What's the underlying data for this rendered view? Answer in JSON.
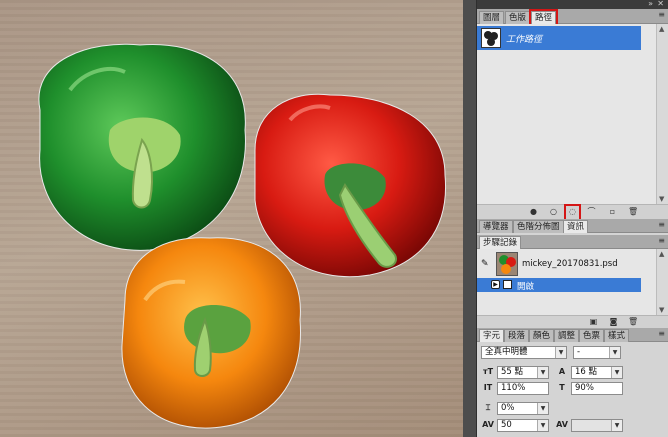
{
  "dock": {
    "collapse_icon": "double-chevron-right-icon",
    "close_icon": "close-icon"
  },
  "paths_panel": {
    "tabs": [
      "圖層",
      "色版",
      "路徑"
    ],
    "active_tab": "路徑",
    "work_path_label": "工作路徑",
    "toolbar_icons": [
      "fill-path-icon",
      "stroke-path-icon",
      "load-path-as-selection-icon",
      "make-work-path-icon",
      "new-path-icon",
      "delete-path-icon"
    ]
  },
  "navigator_tabs": [
    "導覽器",
    "色階分佈圖",
    "資訊"
  ],
  "history_panel": {
    "tab": "步驟記錄",
    "snapshot_name": "mickey_20170831.psd",
    "steps": [
      "開啟"
    ]
  },
  "character_panel": {
    "tabs": [
      "字元",
      "段落",
      "顏色",
      "調整",
      "色票",
      "樣式"
    ],
    "font_family": "全真中明體",
    "font_style": "-",
    "font_size": "55 點",
    "leading": "16 點",
    "vertical_scale": "110%",
    "horizontal_scale": "90%",
    "baseline_shift": "0%",
    "tracking": "50"
  }
}
